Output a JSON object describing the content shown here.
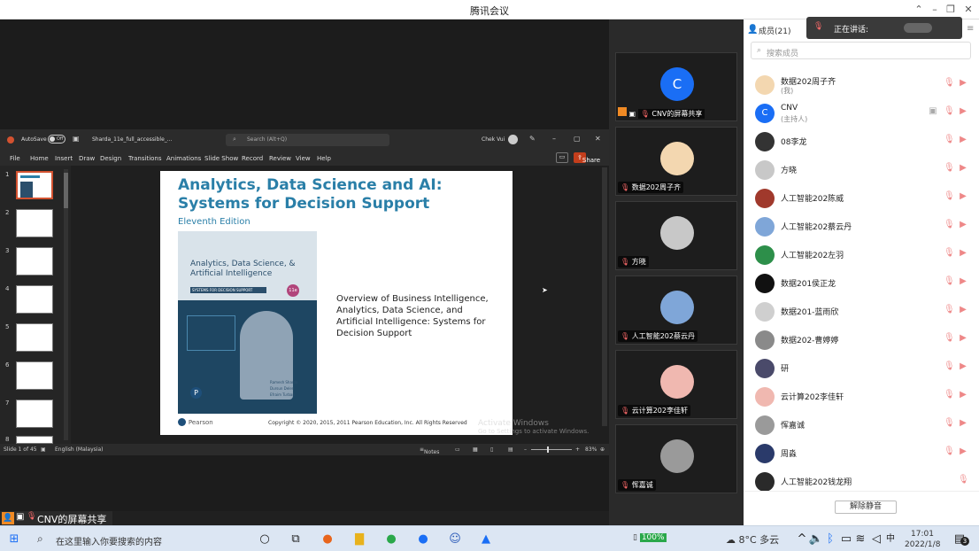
{
  "window": {
    "title": "腾讯会议"
  },
  "ppt": {
    "autosave_label": "AutoSave",
    "autosave_state": "Off",
    "file_name": "Sharda_11e_full_accessible_...",
    "search_placeholder": "Search (Alt+Q)",
    "user_name": "Chek Vui",
    "menu": [
      "File",
      "Home",
      "Insert",
      "Draw",
      "Design",
      "Transitions",
      "Animations",
      "Slide Show",
      "Record",
      "Review",
      "View",
      "Help"
    ],
    "share_label": "Share",
    "thumb_numbers": [
      "1",
      "2",
      "3",
      "4",
      "5",
      "6",
      "7",
      "8"
    ],
    "status": {
      "slide_info": "Slide 1 of 45",
      "language": "English (Malaysia)",
      "notes": "Notes",
      "zoom": "83%"
    }
  },
  "slide": {
    "title_line1": "Analytics, Data Science and AI:",
    "title_line2": "Systems for Decision Support",
    "edition": "Eleventh Edition",
    "cover_title": "Analytics, Data Science, & Artificial Intelligence",
    "cover_subtitle": "SYSTEMS FOR DECISION SUPPORT",
    "cover_badge": "11e",
    "cover_authors": [
      "Ramesh Sharda",
      "Dursun Delen",
      "Efraim Turban"
    ],
    "overview": "Overview of Business Intelligence, Analytics, Data Science, and Artificial Intelligence: Systems for Decision Support",
    "publisher": "Pearson",
    "copyright": "Copyright © 2020, 2015, 2011 Pearson Education, Inc. All Rights Reserved",
    "watermark_line1": "Activate Windows",
    "watermark_line2": "Go to Settings to activate Windows."
  },
  "shared_label": "CNV的屏幕共享",
  "video_tiles": [
    {
      "label": "CNV的屏幕共享",
      "initial": "C",
      "color": "#1a6ef5"
    },
    {
      "label": "数据202周子齐",
      "initial": "",
      "color": "#f3d7b0"
    },
    {
      "label": "方晓",
      "initial": "",
      "color": "#c8c8c8"
    },
    {
      "label": "人工智能202蔡云丹",
      "initial": "",
      "color": "#7fa6d8"
    },
    {
      "label": "云计算202李佳轩",
      "initial": "",
      "color": "#f0b8b0"
    },
    {
      "label": "恽嘉诚",
      "initial": "",
      "color": "#9a9a9a"
    }
  ],
  "panel": {
    "members_title": "成员(21)",
    "speaking_label": "正在讲话:",
    "search_placeholder": "搜索成员",
    "unmute_button": "解除静音",
    "members": [
      {
        "name": "数据202周子齐",
        "sub": "(我)",
        "initial": "",
        "color": "#f3d7b0"
      },
      {
        "name": "CNV",
        "sub": "(主持人)",
        "initial": "C",
        "color": "#1a6ef5"
      },
      {
        "name": "08李龙",
        "sub": "",
        "initial": "",
        "color": "#333333"
      },
      {
        "name": "方晓",
        "sub": "",
        "initial": "",
        "color": "#c8c8c8"
      },
      {
        "name": "人工智能202陈威",
        "sub": "",
        "initial": "",
        "color": "#a0392c"
      },
      {
        "name": "人工智能202蔡云丹",
        "sub": "",
        "initial": "",
        "color": "#7fa6d8"
      },
      {
        "name": "人工智能202左羽",
        "sub": "",
        "initial": "",
        "color": "#2d8f4a"
      },
      {
        "name": "数据201侯正龙",
        "sub": "",
        "initial": "",
        "color": "#111111"
      },
      {
        "name": "数据201-蓝雨欣",
        "sub": "",
        "initial": "",
        "color": "#cfcfcf"
      },
      {
        "name": "数据202-曹婷婷",
        "sub": "",
        "initial": "",
        "color": "#8a8a8a"
      },
      {
        "name": "研",
        "sub": "",
        "initial": "",
        "color": "#4a4a6a"
      },
      {
        "name": "云计算202李佳轩",
        "sub": "",
        "initial": "",
        "color": "#f0b8b0"
      },
      {
        "name": "恽嘉诚",
        "sub": "",
        "initial": "",
        "color": "#9a9a9a"
      },
      {
        "name": "周淼",
        "sub": "",
        "initial": "",
        "color": "#2a3a6a"
      },
      {
        "name": "人工智能202钱龙翔",
        "sub": "",
        "initial": "",
        "color": "#2a2a2a"
      }
    ]
  },
  "taskbar": {
    "search_placeholder": "在这里输入你要搜索的内容",
    "battery": "100%",
    "weather": "8°C 多云",
    "ime": "中",
    "time": "17:01",
    "date": "2022/1/8",
    "notifications": "3"
  }
}
